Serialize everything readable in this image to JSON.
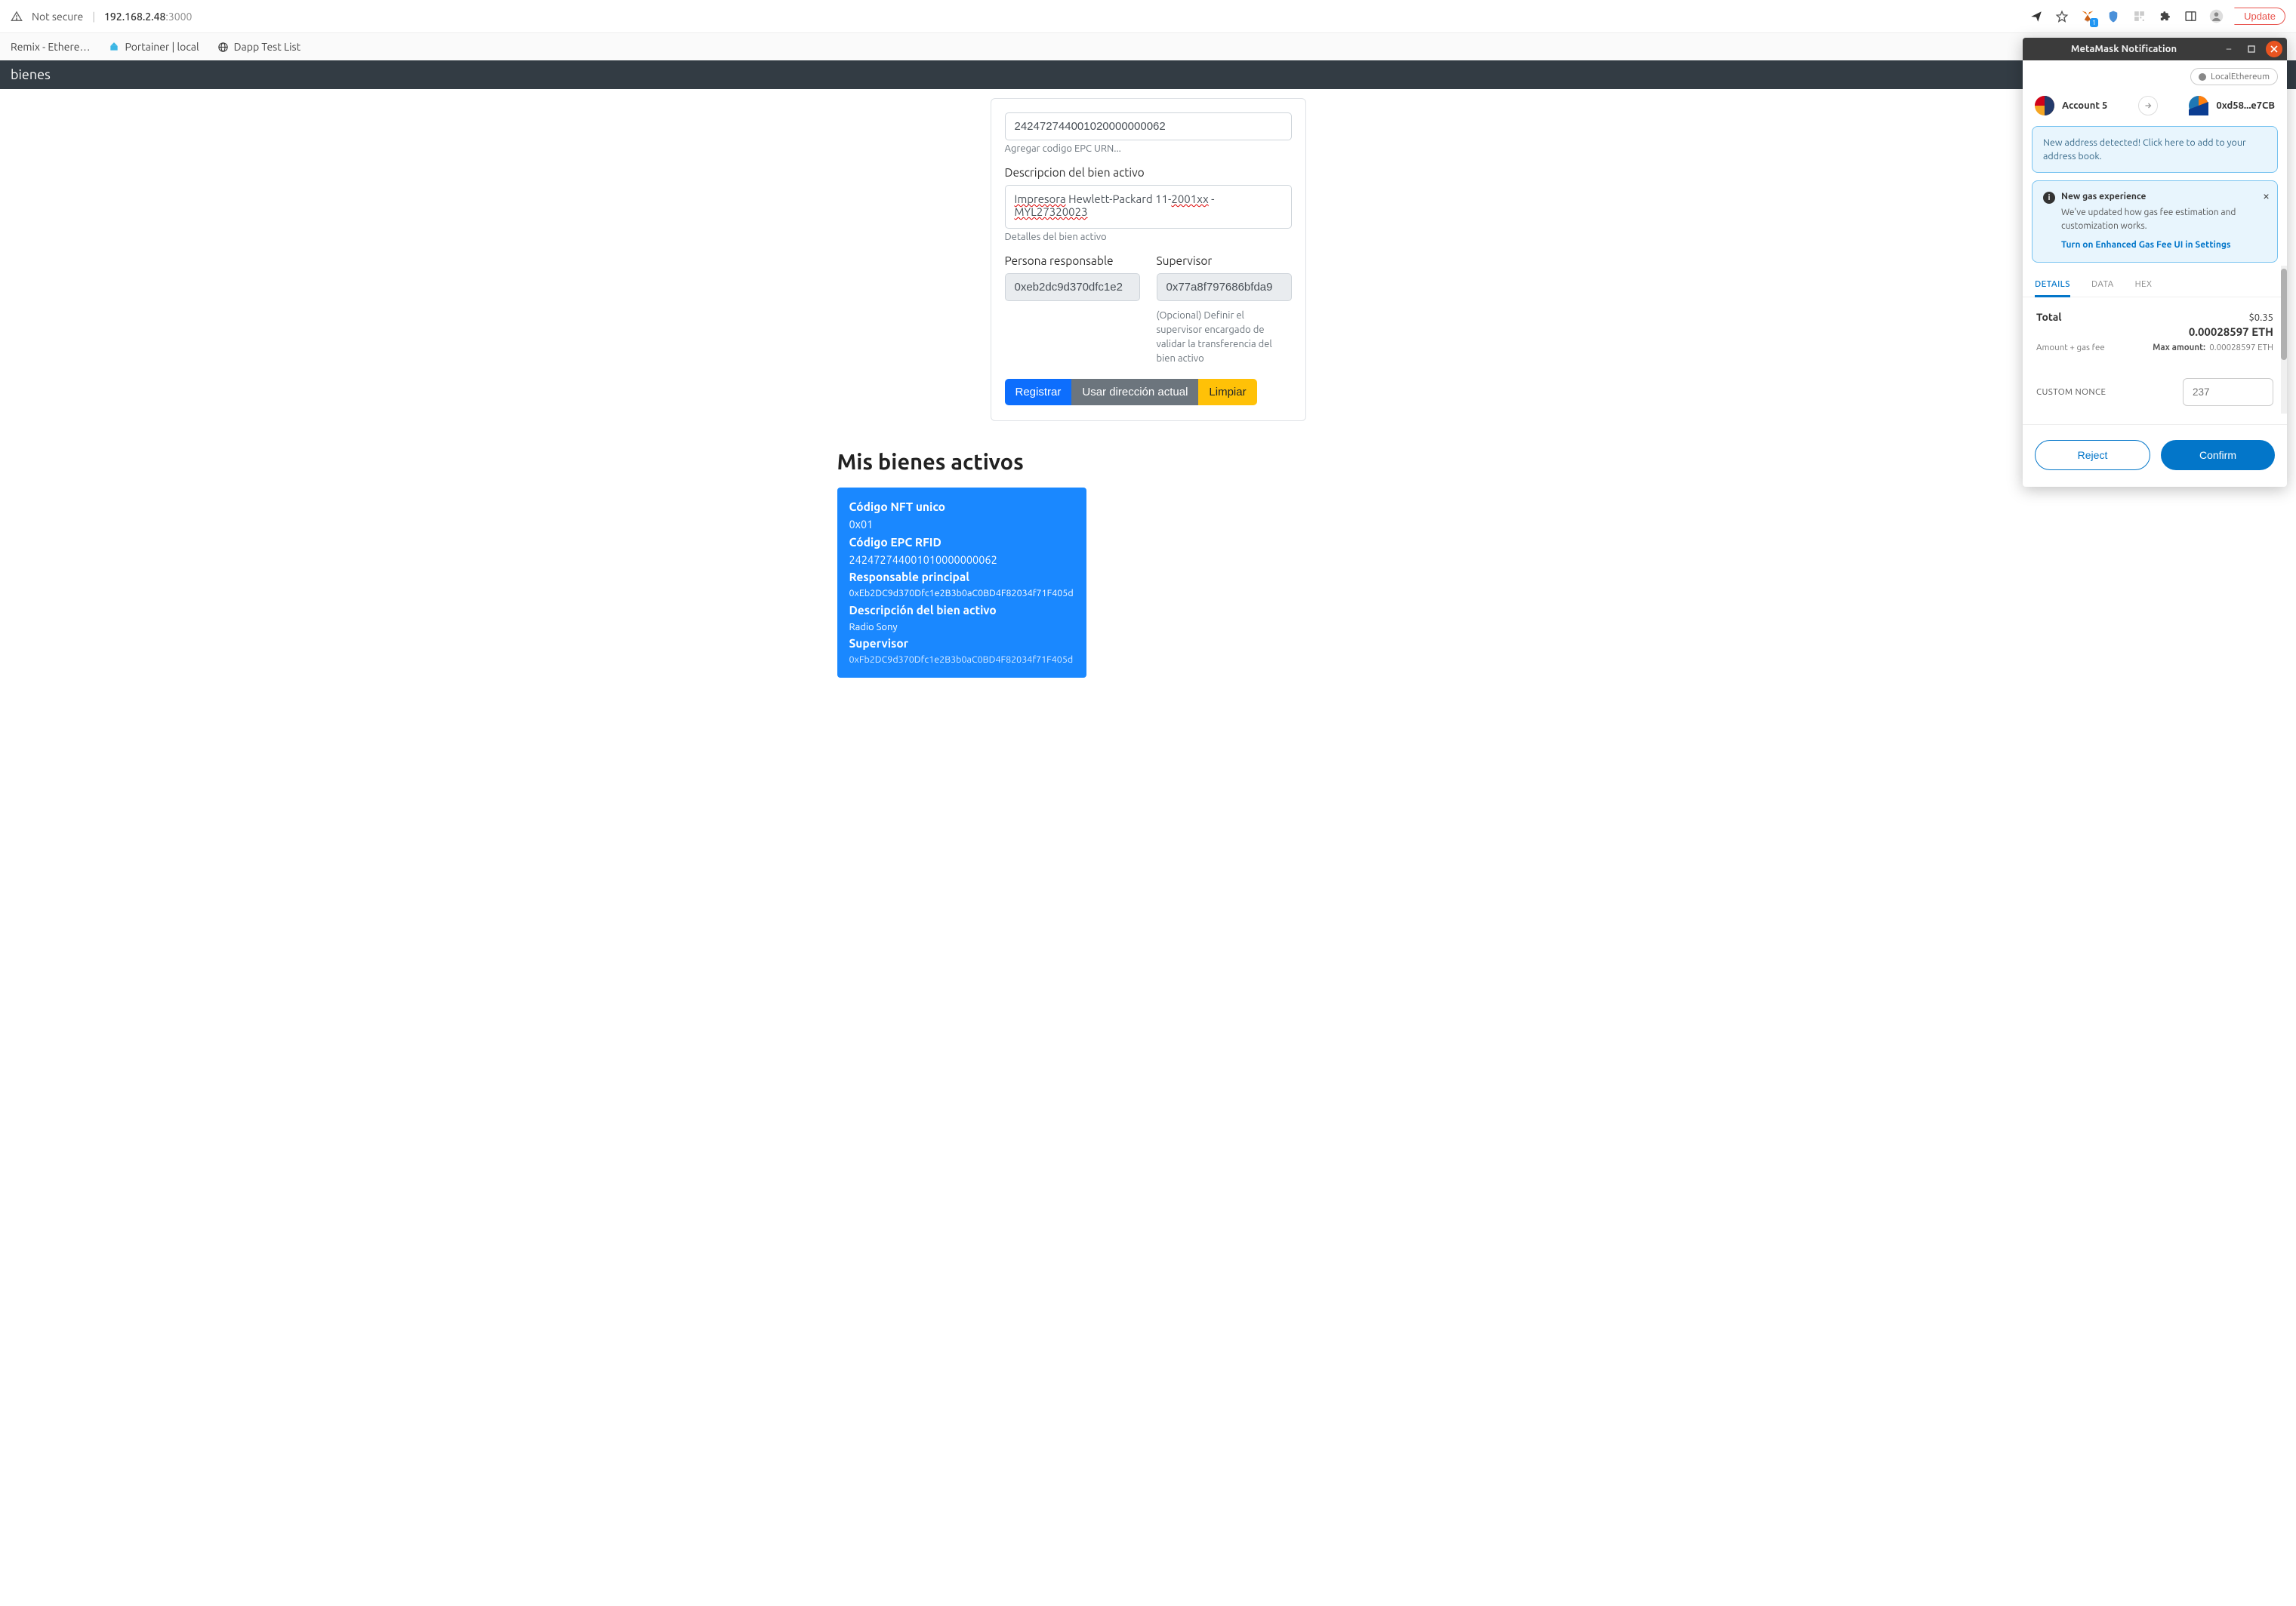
{
  "browser": {
    "not_secure": "Not secure",
    "url_host": "192.168.2.48",
    "url_port": ":3000",
    "update_label": "Update",
    "ext_badge": "1"
  },
  "bookmarks": {
    "remix": "Remix - Ethere…",
    "portainer": "Portainer | local",
    "dapp": "Dapp Test List"
  },
  "banner": {
    "title": "bienes"
  },
  "form": {
    "epc_value": "242472744001020000000062",
    "epc_helper": "Agregar codigo EPC URN...",
    "desc_label": "Descripcion del bien activo",
    "desc_value_p1": "Impresora",
    "desc_value_p2": " Hewlett-Packard 11-",
    "desc_value_p3": "2001xx",
    "desc_value_p4": " - ",
    "desc_value_p5": "MYL27320023",
    "desc_helper": "Detalles del bien activo",
    "resp_label": "Persona responsable",
    "resp_value": "0xeb2dc9d370dfc1e2",
    "super_label": "Supervisor",
    "super_value": "0x77a8f797686bfda9",
    "super_helper": "(Opcional) Definir el supervisor encargado de validar la transferencia del bien activo",
    "btn_register": "Registrar",
    "btn_use_addr": "Usar dirección actual",
    "btn_clear": "Limpiar"
  },
  "assets": {
    "title": "Mis bienes activos",
    "nft_label": "Código NFT unico",
    "nft_value": "0x01",
    "epc_label": "Código EPC RFID",
    "epc_value": "242472744001010000000062",
    "resp_label": "Responsable principal",
    "resp_value": "0xEb2DC9d370Dfc1e2B3b0aC0BD4F82034f71F405d",
    "desc_label": "Descripción del bien activo",
    "desc_value": "Radio Sony",
    "super_label": "Supervisor",
    "super_value": "0xFb2DC9d370Dfc1e2B3b0aC0BD4F82034f71F405d"
  },
  "mm": {
    "title": "MetaMask Notification",
    "network": "LocalEthereum",
    "acc_from": "Account 5",
    "acc_to": "0xd58...e7CB",
    "alert_new_addr": "New address detected! Click here to add to your address book.",
    "gas_hdr": "New gas experience",
    "gas_body": "We've updated how gas fee estimation and customization works.",
    "gas_link": "Turn on Enhanced Gas Fee UI in Settings",
    "tabs": {
      "details": "DETAILS",
      "data": "DATA",
      "hex": "HEX"
    },
    "total_label": "Total",
    "usd": "$0.35",
    "eth": "0.00028597 ETH",
    "sub_left": "Amount + gas fee",
    "sub_max_label": "Max amount:",
    "sub_max_val": "0.00028597 ETH",
    "nonce_label": "CUSTOM NONCE",
    "nonce_value": "237",
    "reject": "Reject",
    "confirm": "Confirm"
  }
}
